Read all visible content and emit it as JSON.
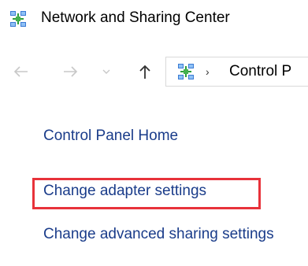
{
  "window": {
    "title": "Network and Sharing Center",
    "title_icon": "network-icon"
  },
  "navigation": {
    "back_icon": "arrow-left-icon",
    "forward_icon": "arrow-right-icon",
    "recent_icon": "chevron-down-icon",
    "up_icon": "arrow-up-icon",
    "address": {
      "icon": "network-icon",
      "separator": "›",
      "path_text": "Control P"
    }
  },
  "sidebar": {
    "home_link": "Control Panel Home",
    "links": [
      {
        "label": "Change adapter settings",
        "highlighted": true
      },
      {
        "label": "Change advanced sharing settings",
        "highlighted": false
      }
    ]
  },
  "colors": {
    "link": "#1a3c8a",
    "highlight": "#e8323a",
    "disabled_icon": "#c8c8c8"
  }
}
